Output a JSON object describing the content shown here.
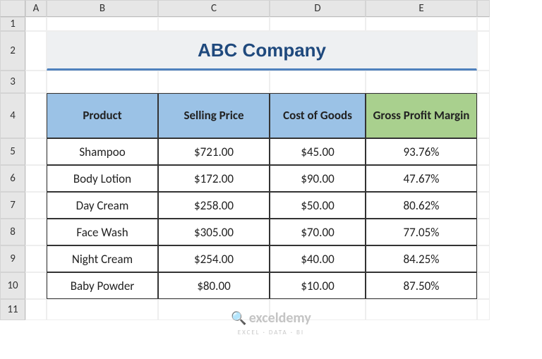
{
  "columns": [
    "A",
    "B",
    "C",
    "D",
    "E"
  ],
  "rows": [
    "1",
    "2",
    "3",
    "4",
    "5",
    "6",
    "7",
    "8",
    "9",
    "10",
    "11"
  ],
  "title": "ABC Company",
  "headers": {
    "product": "Product",
    "selling_price": "Selling Price",
    "cost_of_goods": "Cost of Goods",
    "gross_profit_margin": "Gross Profit Margin"
  },
  "data": [
    {
      "product": "Shampoo",
      "selling_price": "$721.00",
      "cost_of_goods": "$45.00",
      "margin": "93.76%"
    },
    {
      "product": "Body Lotion",
      "selling_price": "$172.00",
      "cost_of_goods": "$90.00",
      "margin": "47.67%"
    },
    {
      "product": "Day Cream",
      "selling_price": "$258.00",
      "cost_of_goods": "$50.00",
      "margin": "80.62%"
    },
    {
      "product": "Face Wash",
      "selling_price": "$305.00",
      "cost_of_goods": "$70.00",
      "margin": "77.05%"
    },
    {
      "product": "Night Cream",
      "selling_price": "$254.00",
      "cost_of_goods": "$40.00",
      "margin": "84.25%"
    },
    {
      "product": "Baby Powder",
      "selling_price": "$80.00",
      "cost_of_goods": "$10.00",
      "margin": "87.50%"
    }
  ],
  "watermark": {
    "title": "exceldemy",
    "sub": "EXCEL · DATA · BI"
  }
}
